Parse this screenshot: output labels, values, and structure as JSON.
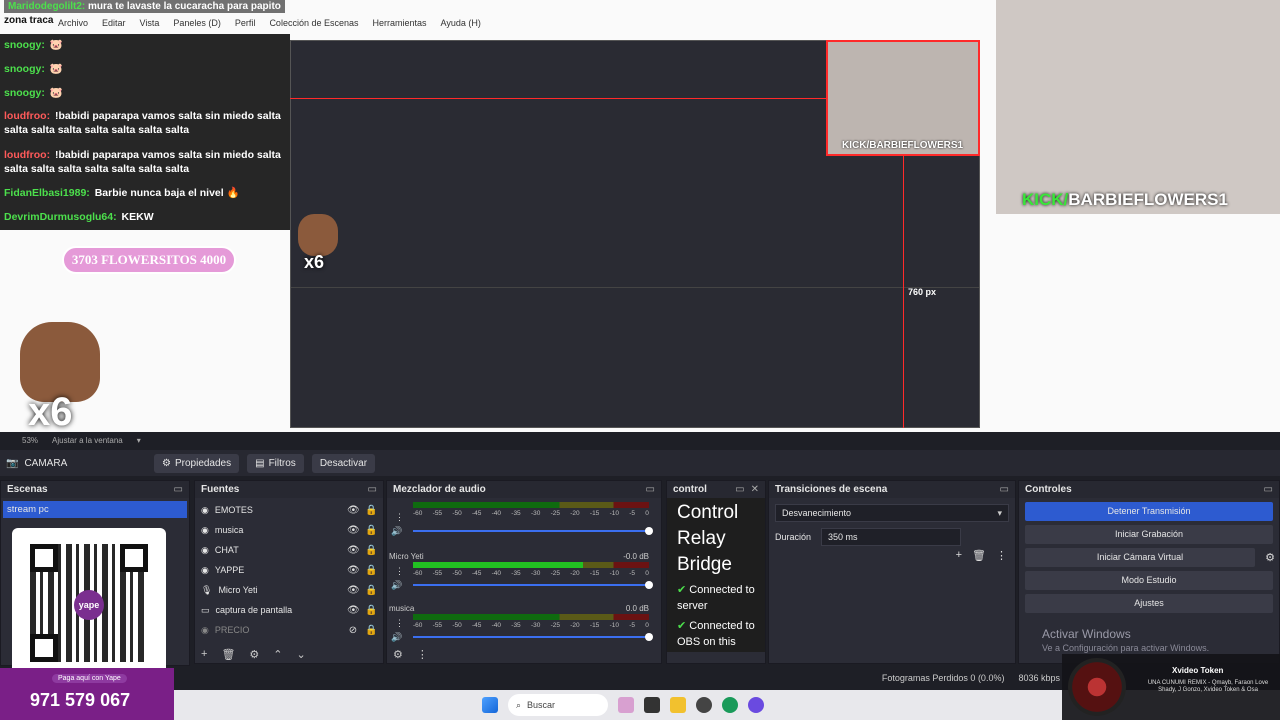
{
  "overlay": {
    "stream_user": "Maridodegolilt2:",
    "stream_text": "mura te lavaste la cucaracha para papito",
    "subtitle": "zona traca",
    "menu": [
      "Archivo",
      "Editar",
      "Vista",
      "Paneles (D)",
      "Perfil",
      "Colección de Escenas",
      "Herramientas",
      "Ayuda (H)"
    ],
    "chat": [
      {
        "user": "snoogy:",
        "text": "🐷"
      },
      {
        "user": "snoogy:",
        "text": "🐷"
      },
      {
        "user": "snoogy:",
        "text": "🐷"
      },
      {
        "user": "loudfroo:",
        "text": "!babidi paparapa vamos salta sin miedo salta salta salta salta salta salta salta salta"
      },
      {
        "user": "loudfroo:",
        "text": "!babidi paparapa vamos salta sin miedo salta salta salta salta salta salta salta salta"
      },
      {
        "user": "FidanElbasi1989:",
        "text": "Barbie nunca baja el nivel 🔥"
      },
      {
        "user": "DevrimDurmusoglu64:",
        "text": "KEKW"
      }
    ],
    "flowers_pill": "3703  FLOWERSITOS  4000",
    "x6_label": "x6",
    "x6_label_small": "x6",
    "cam_tag_k": "KICK/",
    "cam_tag_name": "BARBIEFLOWERS1",
    "cam_tag_small": "KICK/BARBIEFLOWERS1",
    "px_measure": "760 px"
  },
  "preview_status": {
    "zoom": "53%",
    "fit": "Ajustar a la ventana"
  },
  "source_toolbar": {
    "source_name": "CAMARA",
    "properties": "Propiedades",
    "filters": "Filtros",
    "deactivate": "Desactivar"
  },
  "scenes": {
    "title": "Escenas",
    "items": [
      "stream pc"
    ],
    "yape_caption": "Paga aquí con Yape",
    "yape_number": "971 579 067",
    "qr_logo": "yape"
  },
  "sources": {
    "title": "Fuentes",
    "items": [
      {
        "name": "EMOTES",
        "icon": "group-icon"
      },
      {
        "name": "musica",
        "icon": "globe-icon"
      },
      {
        "name": "CHAT",
        "icon": "globe-icon"
      },
      {
        "name": "YAPPE",
        "icon": "globe-icon"
      },
      {
        "name": "Micro Yeti",
        "icon": "mic-icon"
      },
      {
        "name": "captura de pantalla",
        "icon": "monitor-icon"
      },
      {
        "name": "PRECIO",
        "icon": "globe-icon"
      }
    ]
  },
  "mixer": {
    "title": "Mezclador de audio",
    "ticks": [
      "-60",
      "-55",
      "-50",
      "-45",
      "-40",
      "-35",
      "-30",
      "-25",
      "-20",
      "-15",
      "-10",
      "-5",
      "0"
    ],
    "channels": [
      {
        "name": "",
        "db": "",
        "level": 0.0
      },
      {
        "name": "Micro Yeti",
        "db": "-0.0 dB",
        "level": 0.72
      },
      {
        "name": "musica",
        "db": "0.0 dB",
        "level": 0.0
      }
    ]
  },
  "control": {
    "title": "control",
    "relay": [
      "Control",
      "Relay",
      "Bridge"
    ],
    "status1": "Connected to server",
    "status2": "Connected to OBS on this"
  },
  "transitions": {
    "title": "Transiciones de escena",
    "selected": "Desvanecimiento",
    "duration_label": "Duración",
    "duration_value": "350 ms"
  },
  "controls": {
    "title": "Controles",
    "stop_stream": "Detener Transmisión",
    "start_recording": "Iniciar Grabación",
    "virtual_cam": "Iniciar Cámara Virtual",
    "studio_mode": "Modo Estudio",
    "settings": "Ajustes",
    "activate_title": "Activar Windows",
    "activate_sub": "Ve a Configuración para activar Windows."
  },
  "status": {
    "dropped": "Fotogramas Perdidos 0 (0.0%)",
    "bitrate": "8036 kbps"
  },
  "taskbar": {
    "search": "Buscar"
  },
  "now_playing": {
    "title": "Xvideo Token",
    "subtitle": "UNA CUNUMI REMIX - Qmayb, Faraon Love Shady, J Gonzo, Xvideo Token & Osa"
  },
  "colors": {
    "accent": "#2d5bd0",
    "yape": "#7a1f87",
    "kick": "#39e639"
  }
}
